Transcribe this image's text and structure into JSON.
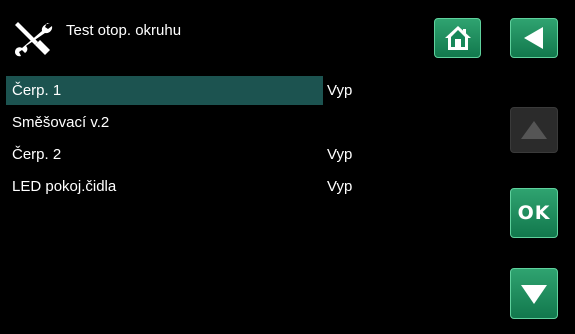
{
  "header": {
    "title": "Test otop. okruhu",
    "tools_icon": "tools-icon"
  },
  "nav": {
    "home_icon": "home-icon",
    "back_icon": "back-arrow-icon",
    "up_icon": "up-arrow-icon",
    "ok_label": "OK",
    "down_icon": "down-arrow-icon"
  },
  "items": [
    {
      "name": "Čerp. 1",
      "value": "Vyp",
      "selected": true
    },
    {
      "name": "Směšovací v.2",
      "value": ""
    },
    {
      "name": "Čerp. 2",
      "value": "Vyp"
    },
    {
      "name": "LED pokoj.čidla",
      "value": "Vyp"
    }
  ],
  "colors": {
    "background": "#000000",
    "accent_green": "#17885a",
    "selection": "#1c5350",
    "disabled_button": "#2b2b2b"
  }
}
